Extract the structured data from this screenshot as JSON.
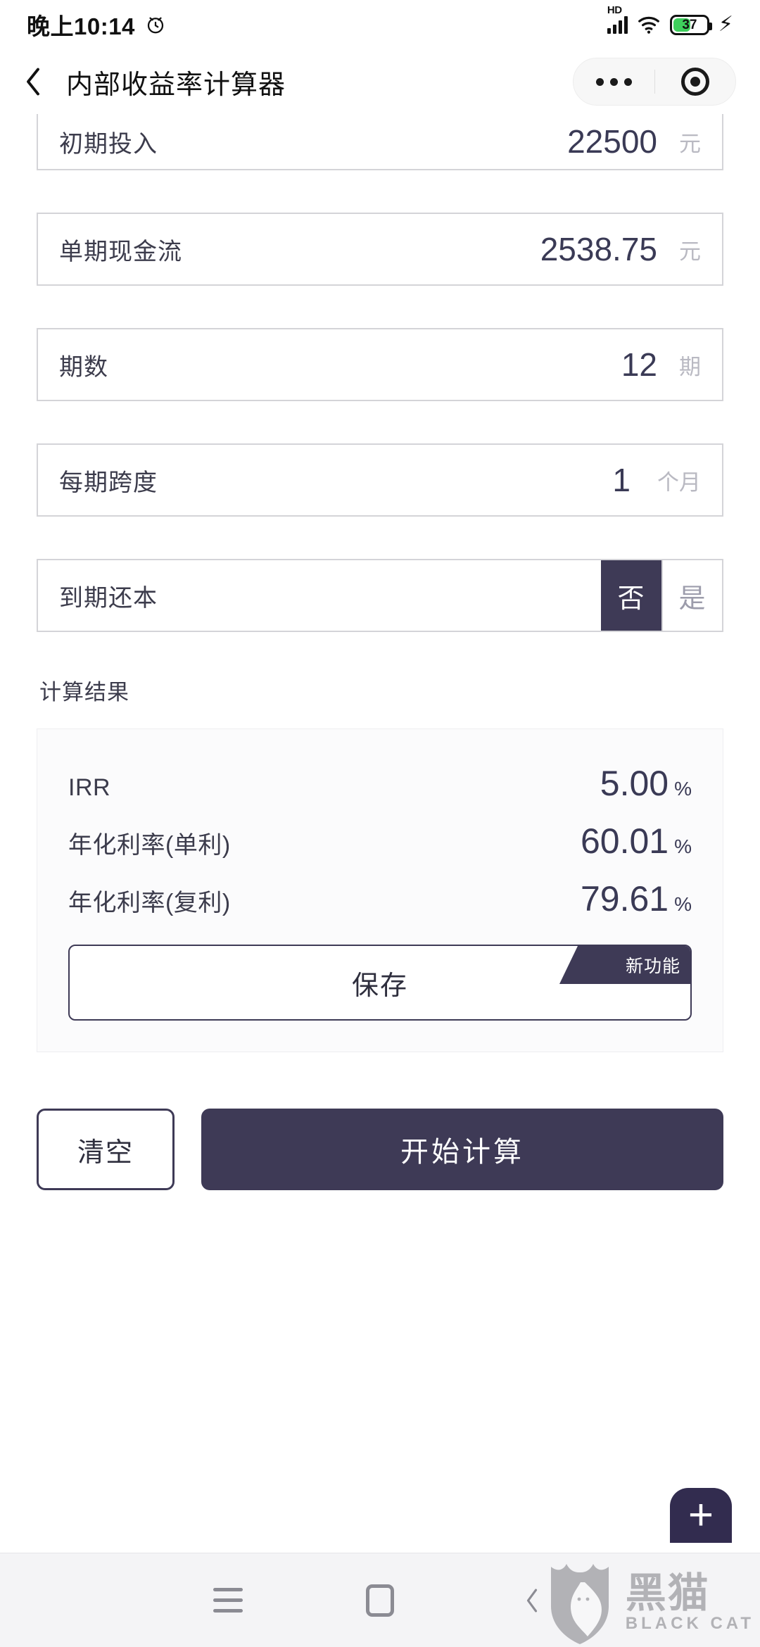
{
  "status_bar": {
    "time": "晚上10:14",
    "alarm_icon": "alarm-clock-icon",
    "network_label": "HD",
    "signal_icon": "cellular-signal-icon",
    "wifi_icon": "wifi-icon",
    "battery_percent": "37",
    "battery_fill_color": "#3ecf5c",
    "charging_icon": "lightning-bolt-icon"
  },
  "nav_bar": {
    "back_icon": "back-chevron-icon",
    "title": "内部收益率计算器",
    "more_icon": "more-dots-icon",
    "capsule_target_icon": "target-circle-icon"
  },
  "theme": {
    "accent": "#3e3a56",
    "value_text": "#3a3a55",
    "unit_text": "#b9b9c2",
    "border": "#d4d4d8"
  },
  "form": {
    "fields": [
      {
        "label": "初期投入",
        "value": "22500",
        "unit": "元",
        "clipped": true
      },
      {
        "label": "单期现金流",
        "value": "2538.75",
        "unit": "元",
        "clipped": false
      },
      {
        "label": "期数",
        "value": "12",
        "unit": "期",
        "clipped": false
      },
      {
        "label": "每期跨度",
        "value": "1",
        "unit": "个月",
        "clipped": false
      }
    ],
    "toggle_field": {
      "label": "到期还本",
      "options": [
        {
          "label": "否",
          "selected": true
        },
        {
          "label": "是",
          "selected": false
        }
      ]
    }
  },
  "results": {
    "section_title": "计算结果",
    "rows": [
      {
        "label": "IRR",
        "value": "5.00",
        "unit": "%"
      },
      {
        "label": "年化利率(单利)",
        "value": "60.01",
        "unit": "%"
      },
      {
        "label": "年化利率(复利)",
        "value": "79.61",
        "unit": "%"
      }
    ],
    "save_button": {
      "label": "保存",
      "ribbon_label": "新功能"
    }
  },
  "actions": {
    "clear_label": "清空",
    "calculate_label": "开始计算"
  },
  "fab": {
    "icon": "plus-icon",
    "label": "+"
  },
  "android_nav": {
    "recents_icon": "recents-menu-icon",
    "home_icon": "home-square-icon",
    "back_icon": "back-chevron-icon"
  },
  "watermark": {
    "shield_icon": "black-cat-shield-icon",
    "name_cn": "黑猫",
    "name_en": "BLACK CAT"
  }
}
